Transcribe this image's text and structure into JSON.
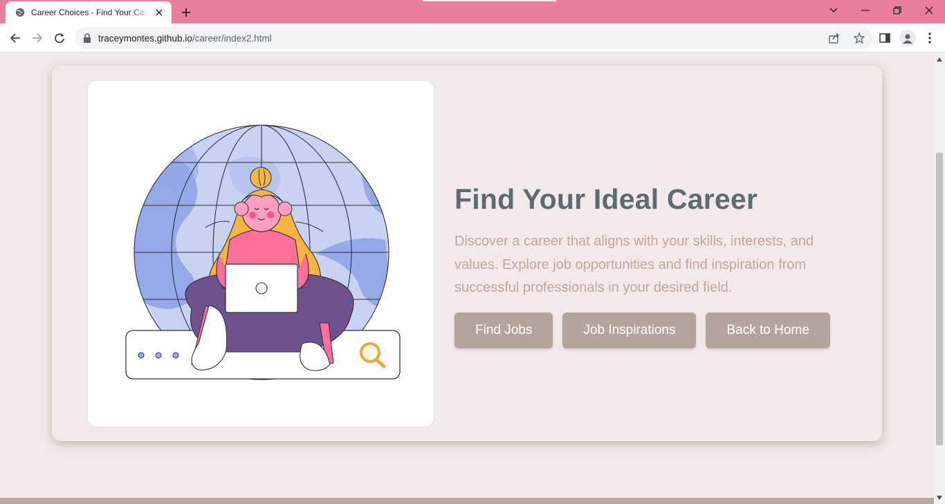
{
  "browser": {
    "tab_title": "Career Choices - Find Your Career",
    "url_host": "traceymontes.github.io",
    "url_path": "/career/index2.html",
    "theme_color": "#e87f9c"
  },
  "hero": {
    "headline": "Find Your Ideal Career",
    "description": "Discover a career that aligns with your skills, interests, and values. Explore job opportunities and find inspiration from successful professionals in your desired field.",
    "buttons": [
      "Find Jobs",
      "Job Inspirations",
      "Back to Home"
    ],
    "illustration": "woman-with-laptop-globe-search-illustration"
  },
  "colors": {
    "background": "#f2e9ea",
    "headline": "#5d6b70",
    "description": "#c3a69a",
    "button": "#b3a59b"
  }
}
